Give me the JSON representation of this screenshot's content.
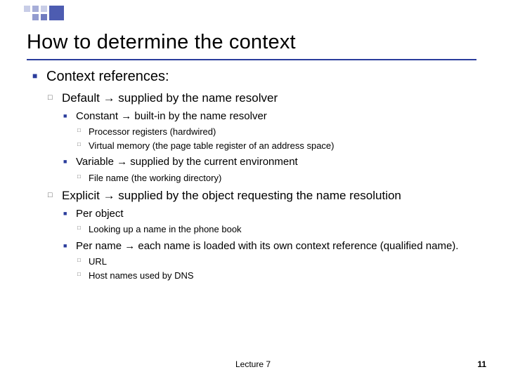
{
  "title": "How to determine the context",
  "body": {
    "heading": "Context references:",
    "default": {
      "label": "Default → supplied by the name resolver",
      "constant": {
        "label": "Constant → built-in by the name resolver",
        "items": [
          "Processor registers (hardwired)",
          "Virtual memory (the page table register of an address space)"
        ]
      },
      "variable": {
        "label": "Variable → supplied by the current environment",
        "items": [
          "File name (the working directory)"
        ]
      }
    },
    "explicit": {
      "label": "Explicit → supplied by the object requesting the name resolution",
      "perObject": {
        "label": "Per object",
        "items": [
          "Looking up a name in the phone book"
        ]
      },
      "perName": {
        "label": "Per name → each name is loaded with its own context reference (qualified name).",
        "items": [
          "URL",
          "Host names used by DNS"
        ]
      }
    }
  },
  "footer": {
    "center": "Lecture 7",
    "page": "11"
  }
}
